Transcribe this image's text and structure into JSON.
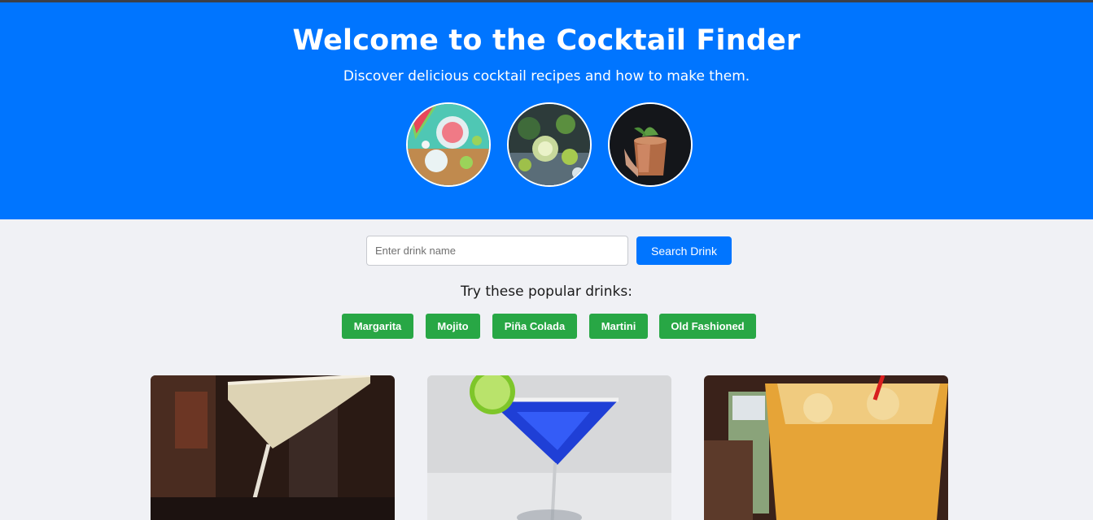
{
  "hero": {
    "title": "Welcome to the Cocktail Finder",
    "subtitle": "Discover delicious cocktail recipes and how to make them.",
    "images": [
      {
        "icon": "watermelon-cocktail-photo"
      },
      {
        "icon": "lime-cocktails-photo"
      },
      {
        "icon": "copper-mug-cocktail-photo"
      }
    ],
    "background_color": "#0075ff"
  },
  "search": {
    "placeholder": "Enter drink name",
    "value": "",
    "button_label": "Search Drink"
  },
  "popular": {
    "label": "Try these popular drinks:",
    "drinks": [
      "Margarita",
      "Mojito",
      "Piña Colada",
      "Martini",
      "Old Fashioned"
    ],
    "chip_color": "#28a745"
  },
  "results": {
    "cards": [
      {
        "icon": "margarita-glass-photo"
      },
      {
        "icon": "blue-martini-photo"
      },
      {
        "icon": "orange-cocktail-photo"
      }
    ]
  }
}
